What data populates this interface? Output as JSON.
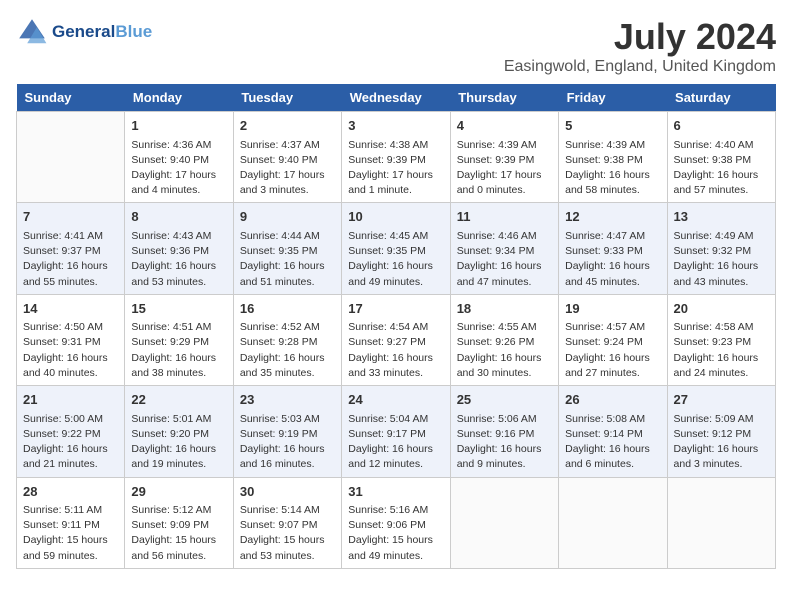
{
  "header": {
    "logo_line1": "General",
    "logo_line2": "Blue",
    "month": "July 2024",
    "location": "Easingwold, England, United Kingdom"
  },
  "weekdays": [
    "Sunday",
    "Monday",
    "Tuesday",
    "Wednesday",
    "Thursday",
    "Friday",
    "Saturday"
  ],
  "weeks": [
    [
      {
        "day": "",
        "empty": true
      },
      {
        "day": "1",
        "sunrise": "Sunrise: 4:36 AM",
        "sunset": "Sunset: 9:40 PM",
        "daylight": "Daylight: 17 hours and 4 minutes."
      },
      {
        "day": "2",
        "sunrise": "Sunrise: 4:37 AM",
        "sunset": "Sunset: 9:40 PM",
        "daylight": "Daylight: 17 hours and 3 minutes."
      },
      {
        "day": "3",
        "sunrise": "Sunrise: 4:38 AM",
        "sunset": "Sunset: 9:39 PM",
        "daylight": "Daylight: 17 hours and 1 minute."
      },
      {
        "day": "4",
        "sunrise": "Sunrise: 4:39 AM",
        "sunset": "Sunset: 9:39 PM",
        "daylight": "Daylight: 17 hours and 0 minutes."
      },
      {
        "day": "5",
        "sunrise": "Sunrise: 4:39 AM",
        "sunset": "Sunset: 9:38 PM",
        "daylight": "Daylight: 16 hours and 58 minutes."
      },
      {
        "day": "6",
        "sunrise": "Sunrise: 4:40 AM",
        "sunset": "Sunset: 9:38 PM",
        "daylight": "Daylight: 16 hours and 57 minutes."
      }
    ],
    [
      {
        "day": "7",
        "sunrise": "Sunrise: 4:41 AM",
        "sunset": "Sunset: 9:37 PM",
        "daylight": "Daylight: 16 hours and 55 minutes."
      },
      {
        "day": "8",
        "sunrise": "Sunrise: 4:43 AM",
        "sunset": "Sunset: 9:36 PM",
        "daylight": "Daylight: 16 hours and 53 minutes."
      },
      {
        "day": "9",
        "sunrise": "Sunrise: 4:44 AM",
        "sunset": "Sunset: 9:35 PM",
        "daylight": "Daylight: 16 hours and 51 minutes."
      },
      {
        "day": "10",
        "sunrise": "Sunrise: 4:45 AM",
        "sunset": "Sunset: 9:35 PM",
        "daylight": "Daylight: 16 hours and 49 minutes."
      },
      {
        "day": "11",
        "sunrise": "Sunrise: 4:46 AM",
        "sunset": "Sunset: 9:34 PM",
        "daylight": "Daylight: 16 hours and 47 minutes."
      },
      {
        "day": "12",
        "sunrise": "Sunrise: 4:47 AM",
        "sunset": "Sunset: 9:33 PM",
        "daylight": "Daylight: 16 hours and 45 minutes."
      },
      {
        "day": "13",
        "sunrise": "Sunrise: 4:49 AM",
        "sunset": "Sunset: 9:32 PM",
        "daylight": "Daylight: 16 hours and 43 minutes."
      }
    ],
    [
      {
        "day": "14",
        "sunrise": "Sunrise: 4:50 AM",
        "sunset": "Sunset: 9:31 PM",
        "daylight": "Daylight: 16 hours and 40 minutes."
      },
      {
        "day": "15",
        "sunrise": "Sunrise: 4:51 AM",
        "sunset": "Sunset: 9:29 PM",
        "daylight": "Daylight: 16 hours and 38 minutes."
      },
      {
        "day": "16",
        "sunrise": "Sunrise: 4:52 AM",
        "sunset": "Sunset: 9:28 PM",
        "daylight": "Daylight: 16 hours and 35 minutes."
      },
      {
        "day": "17",
        "sunrise": "Sunrise: 4:54 AM",
        "sunset": "Sunset: 9:27 PM",
        "daylight": "Daylight: 16 hours and 33 minutes."
      },
      {
        "day": "18",
        "sunrise": "Sunrise: 4:55 AM",
        "sunset": "Sunset: 9:26 PM",
        "daylight": "Daylight: 16 hours and 30 minutes."
      },
      {
        "day": "19",
        "sunrise": "Sunrise: 4:57 AM",
        "sunset": "Sunset: 9:24 PM",
        "daylight": "Daylight: 16 hours and 27 minutes."
      },
      {
        "day": "20",
        "sunrise": "Sunrise: 4:58 AM",
        "sunset": "Sunset: 9:23 PM",
        "daylight": "Daylight: 16 hours and 24 minutes."
      }
    ],
    [
      {
        "day": "21",
        "sunrise": "Sunrise: 5:00 AM",
        "sunset": "Sunset: 9:22 PM",
        "daylight": "Daylight: 16 hours and 21 minutes."
      },
      {
        "day": "22",
        "sunrise": "Sunrise: 5:01 AM",
        "sunset": "Sunset: 9:20 PM",
        "daylight": "Daylight: 16 hours and 19 minutes."
      },
      {
        "day": "23",
        "sunrise": "Sunrise: 5:03 AM",
        "sunset": "Sunset: 9:19 PM",
        "daylight": "Daylight: 16 hours and 16 minutes."
      },
      {
        "day": "24",
        "sunrise": "Sunrise: 5:04 AM",
        "sunset": "Sunset: 9:17 PM",
        "daylight": "Daylight: 16 hours and 12 minutes."
      },
      {
        "day": "25",
        "sunrise": "Sunrise: 5:06 AM",
        "sunset": "Sunset: 9:16 PM",
        "daylight": "Daylight: 16 hours and 9 minutes."
      },
      {
        "day": "26",
        "sunrise": "Sunrise: 5:08 AM",
        "sunset": "Sunset: 9:14 PM",
        "daylight": "Daylight: 16 hours and 6 minutes."
      },
      {
        "day": "27",
        "sunrise": "Sunrise: 5:09 AM",
        "sunset": "Sunset: 9:12 PM",
        "daylight": "Daylight: 16 hours and 3 minutes."
      }
    ],
    [
      {
        "day": "28",
        "sunrise": "Sunrise: 5:11 AM",
        "sunset": "Sunset: 9:11 PM",
        "daylight": "Daylight: 15 hours and 59 minutes."
      },
      {
        "day": "29",
        "sunrise": "Sunrise: 5:12 AM",
        "sunset": "Sunset: 9:09 PM",
        "daylight": "Daylight: 15 hours and 56 minutes."
      },
      {
        "day": "30",
        "sunrise": "Sunrise: 5:14 AM",
        "sunset": "Sunset: 9:07 PM",
        "daylight": "Daylight: 15 hours and 53 minutes."
      },
      {
        "day": "31",
        "sunrise": "Sunrise: 5:16 AM",
        "sunset": "Sunset: 9:06 PM",
        "daylight": "Daylight: 15 hours and 49 minutes."
      },
      {
        "day": "",
        "empty": true
      },
      {
        "day": "",
        "empty": true
      },
      {
        "day": "",
        "empty": true
      }
    ]
  ]
}
